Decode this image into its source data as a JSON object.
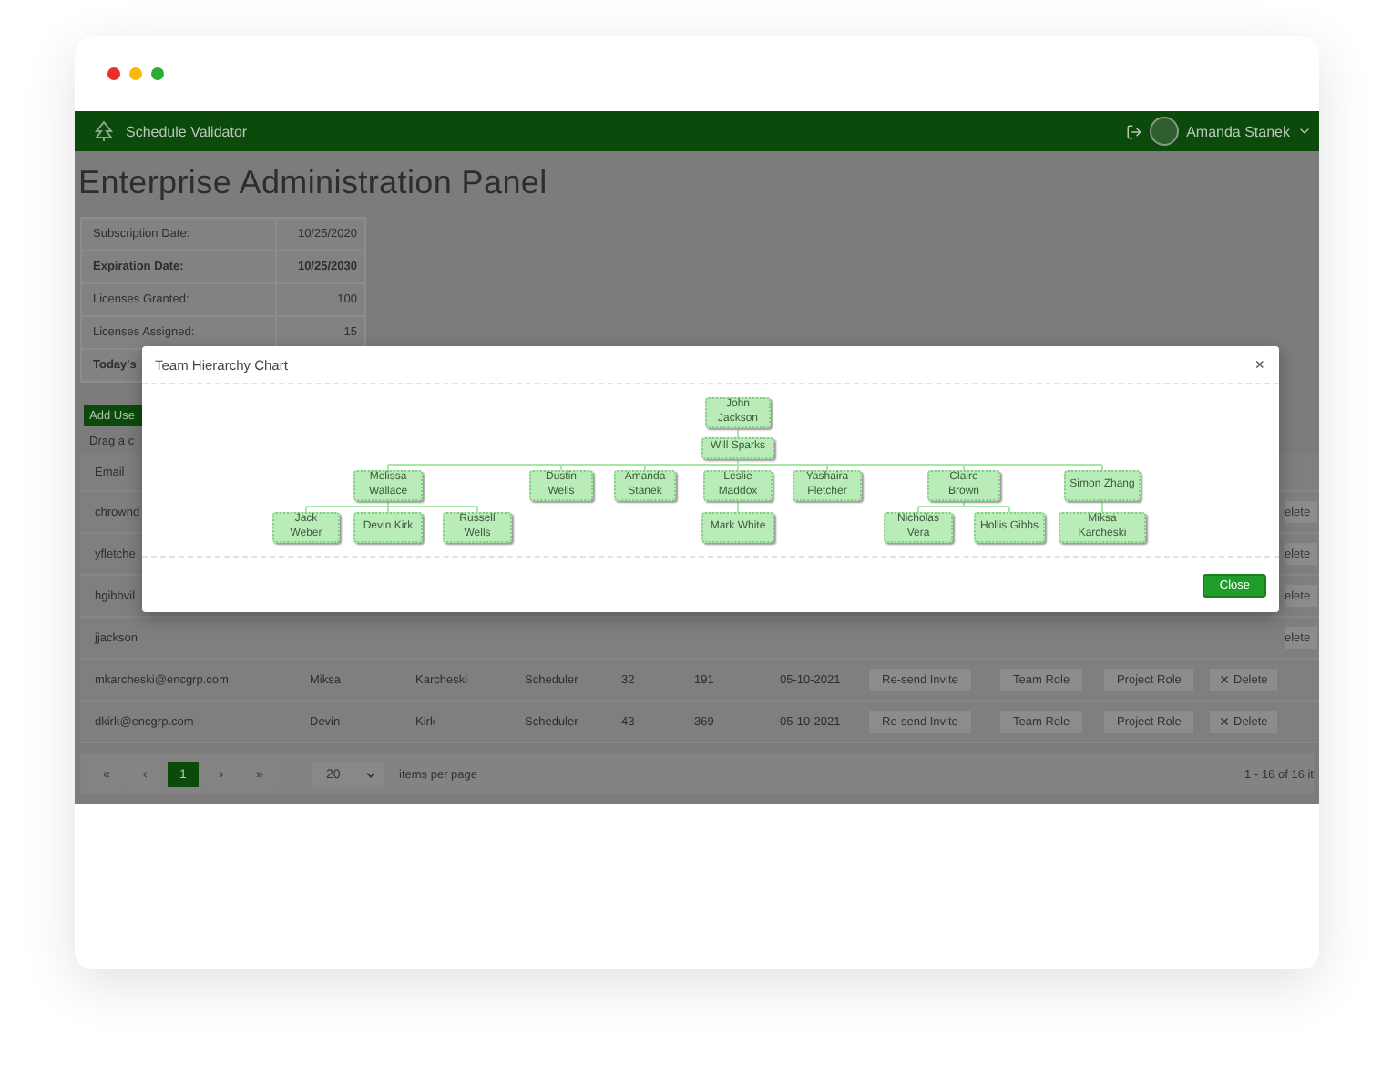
{
  "browser_dots": [
    {
      "color": "#e8302a"
    },
    {
      "color": "#f5b90f"
    },
    {
      "color": "#2bab35"
    }
  ],
  "navbar": {
    "app_name": "Schedule Validator",
    "user_name": "Amanda Stanek"
  },
  "page_title": "Enterprise Administration Panel",
  "license_info": [
    {
      "label": "Subscription Date:",
      "value": "10/25/2020",
      "bold": false
    },
    {
      "label": "Expiration Date:",
      "value": "10/25/2030",
      "bold": true
    },
    {
      "label": "Licenses Granted:",
      "value": "100",
      "bold": false
    },
    {
      "label": "Licenses Assigned:",
      "value": "15",
      "bold": false
    },
    {
      "label": "Today's",
      "bold": true
    }
  ],
  "add_user_button": "Add Use",
  "group_hint": "Drag a c",
  "table": {
    "column_1": "Email",
    "rows": [
      {
        "kind": "covered",
        "email": "chrownd",
        "delete": "elete"
      },
      {
        "kind": "covered",
        "email": "yfletche",
        "delete": "elete"
      },
      {
        "kind": "covered",
        "email": "hgibbvil",
        "delete": "elete"
      },
      {
        "kind": "covered",
        "email": "jjackson",
        "delete": "elete"
      },
      {
        "kind": "full",
        "email": "mkarcheski@encgrp.com",
        "first_name": "Miksa",
        "last_name": "Karcheski",
        "role": "Scheduler",
        "column_5": "32",
        "column_6": "191",
        "date": "05-10-2021",
        "actions": [
          "Re-send Invite",
          "Team Role",
          "Project Role"
        ],
        "delete": "Delete"
      },
      {
        "kind": "full",
        "email": "dkirk@encgrp.com",
        "first_name": "Devin",
        "last_name": "Kirk",
        "role": "Scheduler",
        "column_5": "43",
        "column_6": "369",
        "date": "05-10-2021",
        "actions": [
          "Re-send Invite",
          "Team Role",
          "Project Role"
        ],
        "delete": "Delete"
      }
    ]
  },
  "pager": {
    "prev_buttons": [
      "«",
      "‹"
    ],
    "pages": [
      {
        "label": "1",
        "selected": true
      }
    ],
    "next_buttons": [
      "›",
      "»"
    ],
    "page_size": "20",
    "page_size_label": "items per page",
    "summary": "1 - 16 of 16 it"
  },
  "modal": {
    "title": "Team Hierarchy Chart",
    "close_icon": "×",
    "close_button": "Close",
    "org_chart": {
      "name": "John Jackson",
      "children": [
        {
          "name": "Will Sparks",
          "children": [
            {
              "name": "Melissa Wallace",
              "children": [
                {
                  "name": "Jack Weber"
                },
                {
                  "name": "Devin Kirk"
                },
                {
                  "name": "Russell Wells"
                }
              ]
            },
            {
              "name": "Dustin Wells"
            },
            {
              "name": "Amanda Stanek"
            },
            {
              "name": "Leslie Maddox",
              "children": [
                {
                  "name": "Mark White"
                }
              ]
            },
            {
              "name": "Yashaira Fletcher"
            },
            {
              "name": "Claire Brown",
              "children": [
                {
                  "name": "Nicholas Vera"
                },
                {
                  "name": "Hollis Gibbs"
                }
              ]
            },
            {
              "name": "Simon Zhang",
              "children": [
                {
                  "name": "Miksa Karcheski"
                }
              ]
            }
          ]
        }
      ]
    }
  }
}
